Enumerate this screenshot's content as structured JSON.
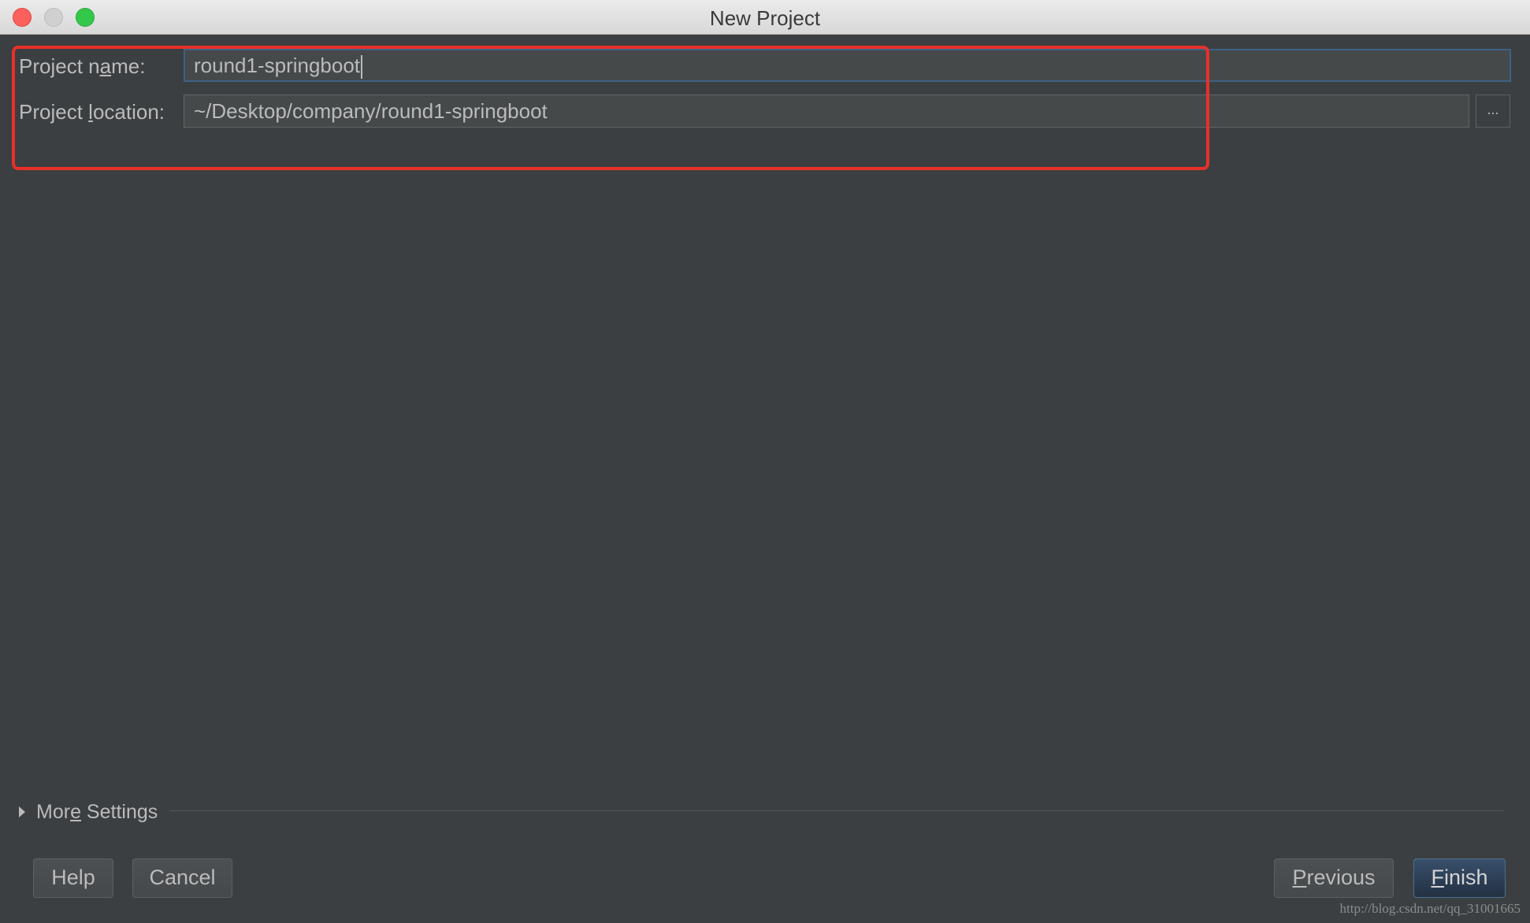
{
  "window": {
    "title": "New Project"
  },
  "form": {
    "name_label_pre": "Project n",
    "name_label_mn": "a",
    "name_label_post": "me:",
    "name_value": "round1-springboot",
    "location_label_pre": "Project ",
    "location_label_mn": "l",
    "location_label_post": "ocation:",
    "location_value": "~/Desktop/company/round1-springboot",
    "browse_label": "..."
  },
  "more_settings": {
    "label_pre": "Mor",
    "label_mn": "e",
    "label_post": " Settings"
  },
  "buttons": {
    "help": "Help",
    "cancel": "Cancel",
    "previous_mn": "P",
    "previous_rest": "revious",
    "finish_mn": "F",
    "finish_rest": "inish"
  },
  "watermark": "http://blog.csdn.net/qq_31001665",
  "colors": {
    "background": "#3c3f41",
    "field": "#45494a",
    "focus_border": "#3d6185",
    "highlight": "#e8302a",
    "default_button": "#2b3d54"
  }
}
